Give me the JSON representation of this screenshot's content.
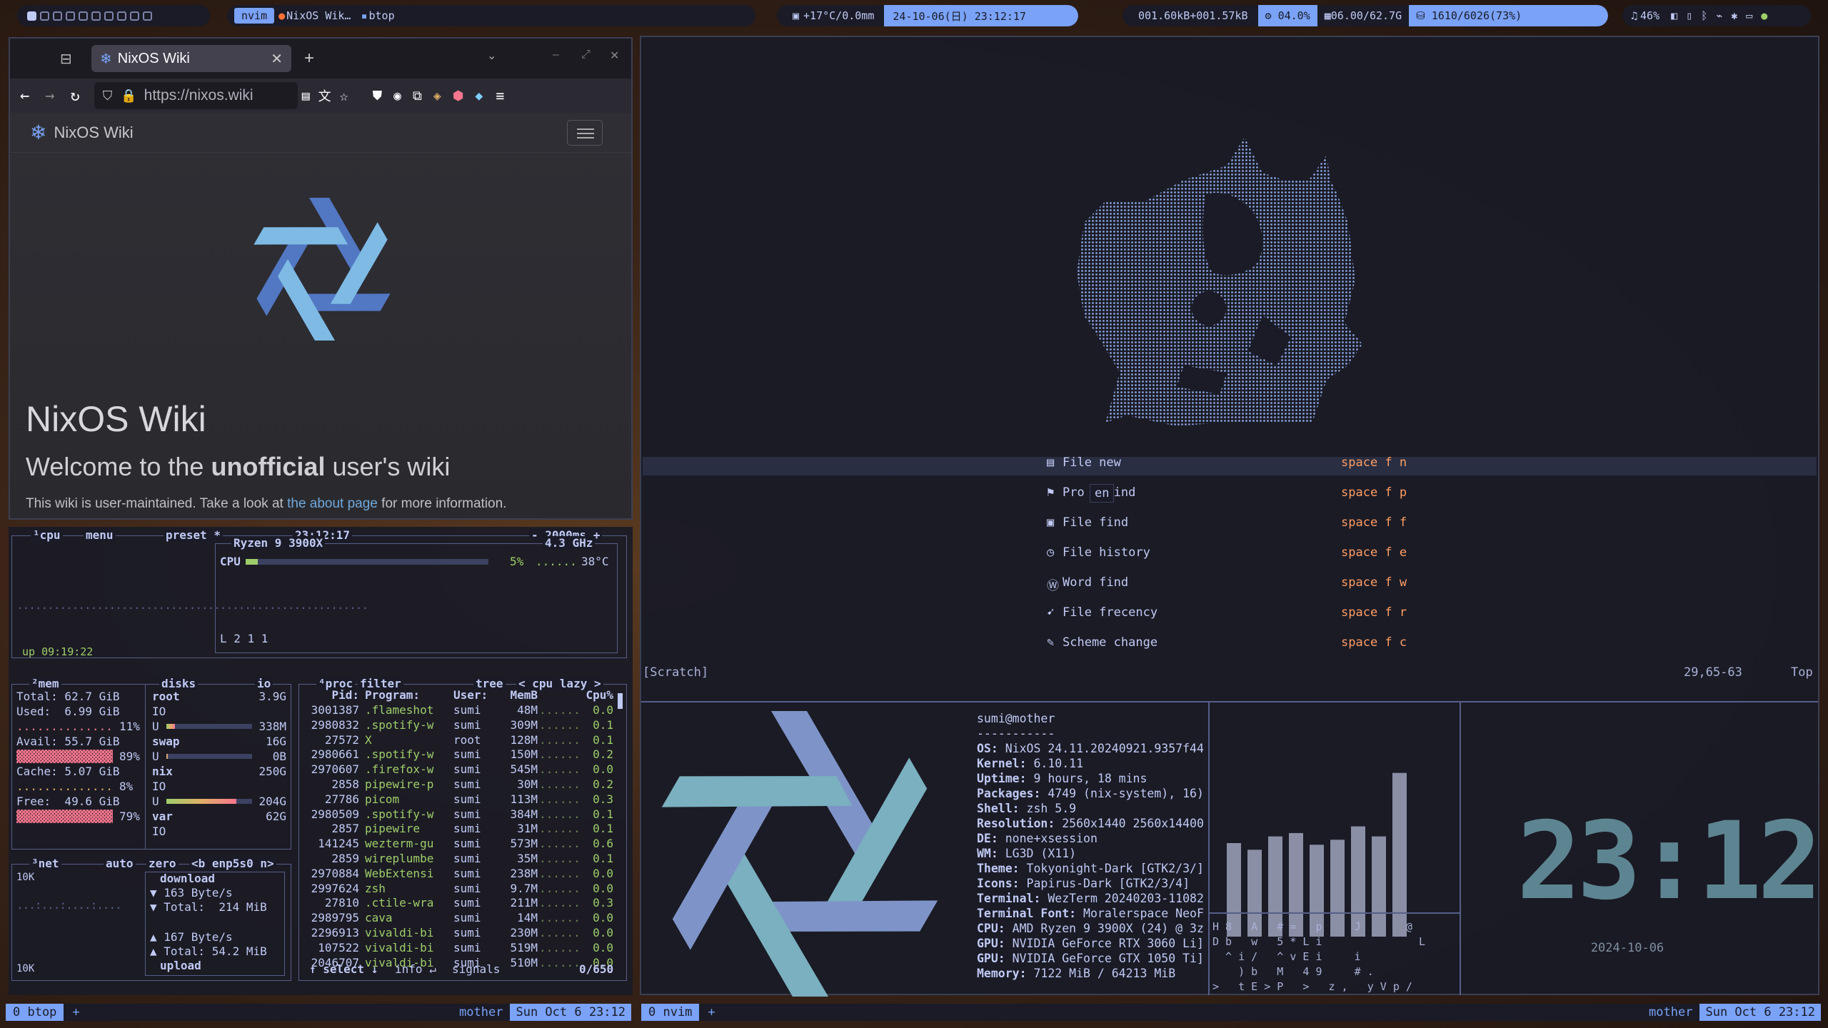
{
  "colors": {
    "accent": "#7aa2f7",
    "bg": "#1a1b26",
    "fg": "#c0caf5",
    "red": "#f7768e",
    "green": "#9ece6a",
    "orange": "#ff9e64",
    "yellow": "#e0af68"
  },
  "topbar": {
    "active_ws": "nvim",
    "tasks": [
      "NixOS Wik…",
      "btop"
    ],
    "weather": "+17°C/0.0mm",
    "datetime": "24-10-06(日) 23:12:17",
    "net": "001.60kB+001.57kB",
    "cpu": "04.0%",
    "mem": "06.00/62.7G",
    "disk": "1610/6026(73%)",
    "volume": "46%"
  },
  "firefox": {
    "tab_title": "NixOS Wiki",
    "url": "https://nixos.wiki",
    "site_name": "NixOS Wiki",
    "page_title": "NixOS Wiki",
    "subtitle_pre": "Welcome to the ",
    "subtitle_bold": "unofficial",
    "subtitle_post": " user's wiki",
    "notice_pre": "This wiki is user-maintained. Take a look at ",
    "notice_link": "the about page",
    "notice_post": " for more information."
  },
  "btop": {
    "cpu_box": {
      "title": "¹cpu",
      "menu": "menu",
      "preset": "preset *",
      "clock": "23:12:17",
      "interval": "- 2000ms +",
      "model": "Ryzen 9 3900X",
      "freq": "4.3 GHz",
      "cpu_label": "CPU",
      "cpu_pct": "5%",
      "cpu_pct_value": 5,
      "temp": "38°C",
      "load": "L 2 1 1",
      "uptime": "up 09:19:22"
    },
    "mem_box": {
      "title": "²mem",
      "total": "Total: 62.7 GiB",
      "used": "Used:  6.99 GiB",
      "used_pct": "11%",
      "avail": "Avail: 55.7 GiB",
      "avail_pct": "89%",
      "cache": "Cache: 5.07 GiB",
      "cache_pct": "8%",
      "free": "Free:  49.6 GiB",
      "free_pct": "79%"
    },
    "disks_box": {
      "title": "disks",
      "io": "io",
      "rows": [
        [
          "root",
          "3.9G"
        ],
        [
          "IO",
          ""
        ],
        [
          "U",
          "338M"
        ],
        [
          "swap",
          "16G"
        ],
        [
          "U",
          "0B"
        ],
        [
          "nix",
          "250G"
        ],
        [
          "IO",
          ""
        ],
        [
          "U",
          "204G"
        ],
        [
          "var",
          "62G"
        ],
        [
          "IO",
          ""
        ]
      ]
    },
    "net_box": {
      "title": "³net",
      "auto": "auto",
      "zero": "zero",
      "iface": "<b enp5s0 n>",
      "scale_top": "10K",
      "scale_bottom": "10K",
      "download": "download",
      "dl_rate": "▼ 163 Byte/s",
      "dl_total": "▼ Total:  214 MiB",
      "ul_rate": "▲ 167 Byte/s",
      "ul_total": "▲ Total: 54.2 MiB",
      "upload": "upload"
    },
    "proc_box": {
      "title": "⁴proc",
      "filter": "filter",
      "tree": "tree",
      "sort": "< cpu lazy >",
      "headers": [
        "Pid:",
        "Program:",
        "User:",
        "MemB",
        "Cpu%"
      ],
      "rows": [
        [
          "3001387",
          ".flameshot",
          "sumi",
          "48M",
          "0.0"
        ],
        [
          "2980832",
          ".spotify-w",
          "sumi",
          "309M",
          "0.1"
        ],
        [
          "27572",
          "X",
          "root",
          "128M",
          "0.1"
        ],
        [
          "2980661",
          ".spotify-w",
          "sumi",
          "150M",
          "0.2"
        ],
        [
          "2970607",
          ".firefox-w",
          "sumi",
          "545M",
          "0.0"
        ],
        [
          "2858",
          "pipewire-p",
          "sumi",
          "30M",
          "0.2"
        ],
        [
          "27786",
          "picom",
          "sumi",
          "113M",
          "0.3"
        ],
        [
          "2980509",
          ".spotify-w",
          "sumi",
          "384M",
          "0.1"
        ],
        [
          "2857",
          "pipewire",
          "sumi",
          "31M",
          "0.1"
        ],
        [
          "141245",
          "wezterm-gu",
          "sumi",
          "573M",
          "0.6"
        ],
        [
          "2859",
          "wireplumbe",
          "sumi",
          "35M",
          "0.1"
        ],
        [
          "2970884",
          "WebExtensi",
          "sumi",
          "238M",
          "0.0"
        ],
        [
          "2997624",
          "zsh",
          "sumi",
          "9.7M",
          "0.0"
        ],
        [
          "27810",
          ".ctile-wra",
          "sumi",
          "211M",
          "0.3"
        ],
        [
          "2989795",
          "cava",
          "sumi",
          "14M",
          "0.0"
        ],
        [
          "2296913",
          "vivaldi-bi",
          "sumi",
          "230M",
          "0.0"
        ],
        [
          "107522",
          "vivaldi-bi",
          "sumi",
          "519M",
          "0.0"
        ],
        [
          "2046707",
          "vivaldi-bi",
          "sumi",
          "510M",
          "0.0"
        ]
      ],
      "footer_select": "↑ select ↓",
      "footer_info": "info ↵",
      "footer_signals": "signals",
      "footer_count": "0/650"
    }
  },
  "tmux_left": {
    "session": "0 btop",
    "plus": "+",
    "host": "mother",
    "date": "Sun Oct 6 23:12"
  },
  "tmux_right": {
    "session": "0 nvim",
    "plus": "+",
    "host": "mother",
    "date": "Sun Oct 6 23:12"
  },
  "nvim": {
    "menu": [
      {
        "label": "File new",
        "key": "space f n"
      },
      {
        "label": "Pro   find",
        "key": "space f p"
      },
      {
        "label": "File find",
        "key": "space f f"
      },
      {
        "label": "File history",
        "key": "space f e"
      },
      {
        "label": "Word find",
        "key": "space f w"
      },
      {
        "label": "File frecency",
        "key": "space f r"
      },
      {
        "label": "Scheme change",
        "key": "space f c"
      }
    ],
    "popup": "en",
    "buffer": "[Scratch]",
    "position": "29,65-63",
    "scroll": "Top"
  },
  "fetch": {
    "user": "sumi@mother",
    "sep": "-----------",
    "lines": [
      [
        "OS:",
        "NixOS 24.11.20240921.9357f44"
      ],
      [
        "Kernel:",
        "6.10.11"
      ],
      [
        "Uptime:",
        "9 hours, 18 mins"
      ],
      [
        "Packages:",
        "4749 (nix-system), 16)"
      ],
      [
        "Shell:",
        "zsh 5.9"
      ],
      [
        "Resolution:",
        "2560x1440 2560x14400"
      ],
      [
        "DE:",
        "none+xsession"
      ],
      [
        "WM:",
        "LG3D (X11)"
      ],
      [
        "Theme:",
        "Tokyonight-Dark [GTK2/3/]"
      ],
      [
        "Icons:",
        "Papirus-Dark [GTK2/3/4]"
      ],
      [
        "Terminal:",
        "WezTerm 20240203-11082"
      ],
      [
        "Terminal Font:",
        "Moralerspace NeoF"
      ],
      [
        "CPU:",
        "AMD Ryzen 9 3900X (24) @ 3z"
      ],
      [
        "GPU:",
        "NVIDIA GeForce RTX 3060 Li]"
      ],
      [
        "GPU:",
        "NVIDIA GeForce GTX 1050 Ti]"
      ],
      [
        "Memory:",
        "7122 MiB / 64213 MiB"
      ]
    ]
  },
  "cava": {
    "bars": [
      0.56,
      0.52,
      0.6,
      0.62,
      0.55,
      0.58,
      0.66,
      0.6,
      0.98
    ]
  },
  "matrix": {
    "lines": [
      "H 8   A   # =   p     J       @",
      "D b   w   5 * L i               L",
      "  ^ i /   ^ v E i     i",
      "    ) b   M   4 9     # .",
      ">   t E > P   >   z ,   y V p /"
    ]
  },
  "clock": {
    "time": "23:12",
    "date": "2024-10-06"
  }
}
